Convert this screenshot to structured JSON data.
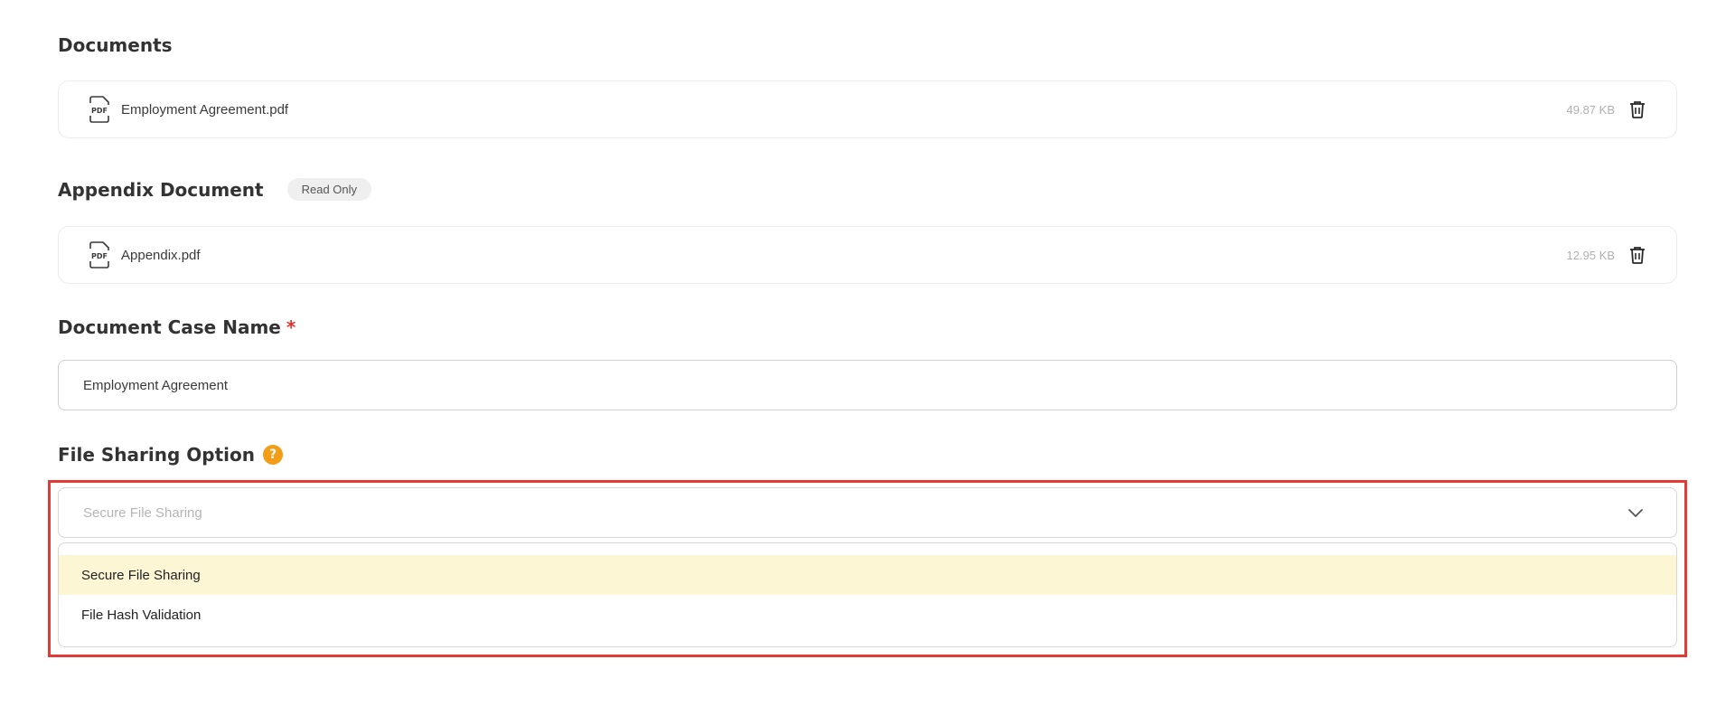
{
  "documents": {
    "title": "Documents",
    "file": {
      "name": "Employment Agreement.pdf",
      "size": "49.87 KB"
    }
  },
  "appendix": {
    "title": "Appendix Document",
    "badge": "Read Only",
    "file": {
      "name": "Appendix.pdf",
      "size": "12.95 KB"
    }
  },
  "case_name": {
    "label": "Document Case Name",
    "required_mark": "*",
    "value": "Employment Agreement"
  },
  "file_sharing": {
    "label": "File Sharing Option",
    "help_icon": "?",
    "selected": "Secure File Sharing",
    "options": [
      "Secure File Sharing",
      "File Hash Validation"
    ],
    "highlighted_option": "Secure File Sharing"
  },
  "colors": {
    "accent_help": "#f29d15",
    "required": "#e5322d",
    "highlight_border": "#e53935",
    "option_hover": "#fdf6d5"
  },
  "icons": {
    "file": "pdf-file-icon",
    "delete": "trash-icon",
    "dropdown": "chevron-down-icon",
    "help": "question-circle-icon"
  }
}
